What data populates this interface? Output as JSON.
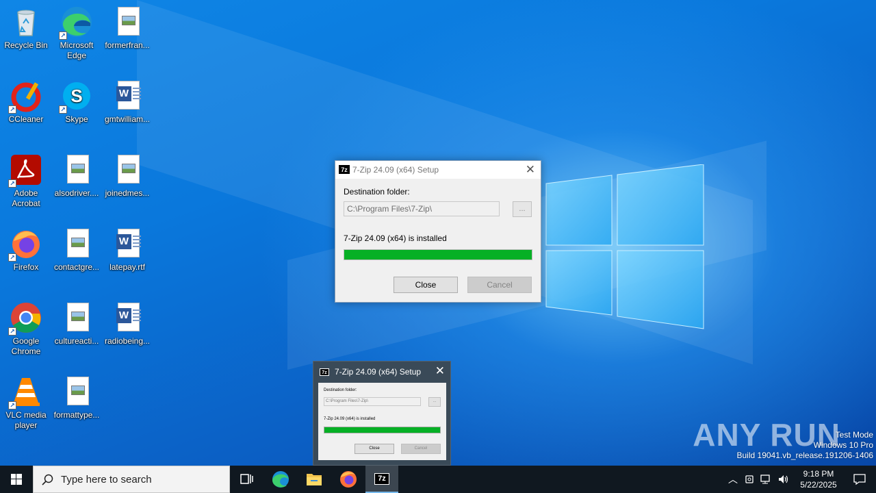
{
  "desktop": {
    "icons": [
      {
        "label": "Recycle Bin"
      },
      {
        "label": "Microsoft Edge"
      },
      {
        "label": "formerfran..."
      },
      {
        "label": "CCleaner"
      },
      {
        "label": "Skype"
      },
      {
        "label": "gmtwilliam..."
      },
      {
        "label": "Adobe Acrobat"
      },
      {
        "label": "alsodriver...."
      },
      {
        "label": "joinedmes..."
      },
      {
        "label": "Firefox"
      },
      {
        "label": "contactgre..."
      },
      {
        "label": "latepay.rtf"
      },
      {
        "label": "Google Chrome"
      },
      {
        "label": "cultureacti..."
      },
      {
        "label": "radiobeing..."
      },
      {
        "label": "VLC media player"
      },
      {
        "label": "formattype..."
      }
    ]
  },
  "setup_dialog": {
    "icon_text": "7z",
    "title": "7-Zip 24.09 (x64) Setup",
    "destination_label": "Destination folder:",
    "destination_value": "C:\\Program Files\\7-Zip\\",
    "browse_label": "...",
    "status": "7-Zip 24.09 (x64) is installed",
    "progress_percent": 100,
    "close_label": "Close",
    "cancel_label": "Cancel"
  },
  "thumbnail": {
    "icon_text": "7z",
    "title": "7-Zip 24.09 (x64) Setup",
    "destination_label": "Destination folder:",
    "destination_value": "C:\\Program Files\\7-Zip\\",
    "browse_label": "...",
    "status": "7-Zip 24.09 (x64) is installed",
    "close_label": "Close",
    "cancel_label": "Cancel"
  },
  "watermark": {
    "logo": "ANY RUN",
    "mode": "Test Mode",
    "edition": "Windows 10 Pro",
    "build": "Build 19041.vb_release.191206-1406"
  },
  "taskbar": {
    "search_placeholder": "Type here to search",
    "active_app_icon": "7z",
    "time": "9:18 PM",
    "date": "5/22/2025"
  },
  "colors": {
    "progress": "#06b025",
    "taskbar": "#101820",
    "accent": "#0078d7"
  }
}
